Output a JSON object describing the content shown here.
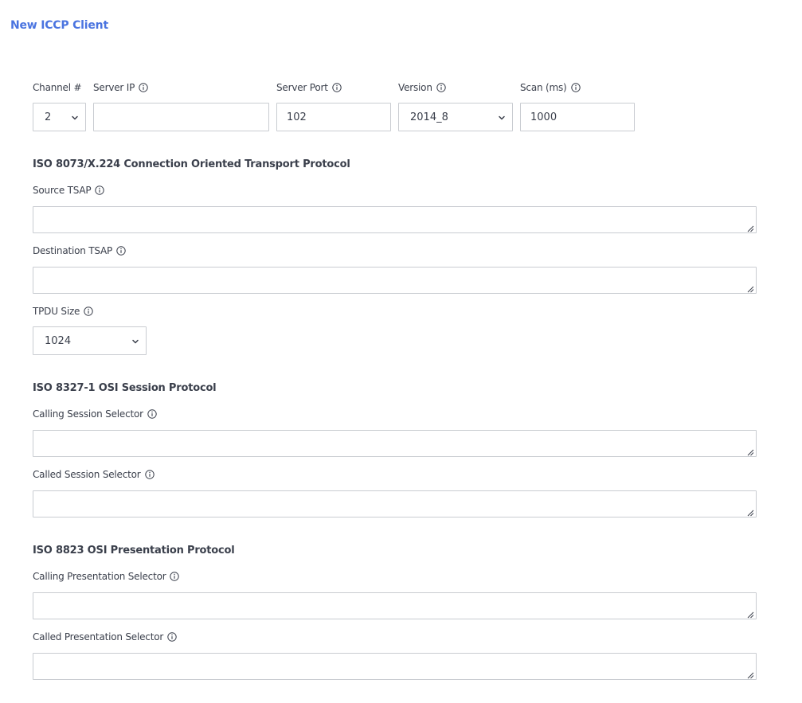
{
  "page": {
    "title": "New ICCP Client"
  },
  "connection": {
    "channel": {
      "label": "Channel #",
      "value": "2"
    },
    "server_ip": {
      "label": "Server IP",
      "value": ""
    },
    "server_port": {
      "label": "Server Port",
      "value": "102"
    },
    "version": {
      "label": "Version",
      "value": "2014_8"
    },
    "scan": {
      "label": "Scan (ms)",
      "value": "1000"
    }
  },
  "transport": {
    "title": "ISO 8073/X.224 Connection Oriented Transport Protocol",
    "source_tsap": {
      "label": "Source TSAP",
      "value": ""
    },
    "destination_tsap": {
      "label": "Destination TSAP",
      "value": ""
    },
    "tpdu_size": {
      "label": "TPDU Size",
      "value": "1024"
    }
  },
  "session": {
    "title": "ISO 8327-1 OSI Session Protocol",
    "calling_selector": {
      "label": "Calling Session Selector",
      "value": ""
    },
    "called_selector": {
      "label": "Called Session Selector",
      "value": ""
    }
  },
  "presentation": {
    "title": "ISO 8823 OSI Presentation Protocol",
    "calling_selector": {
      "label": "Calling Presentation Selector",
      "value": ""
    },
    "called_selector": {
      "label": "Called Presentation Selector",
      "value": ""
    }
  },
  "icons": {
    "info": "info-circle-icon",
    "dropdown": "chevron-down-icon",
    "resize": "resize-grip-icon"
  },
  "colors": {
    "title": "#4a74e0",
    "text": "#3a3f4b",
    "border": "#c9ccd1"
  }
}
